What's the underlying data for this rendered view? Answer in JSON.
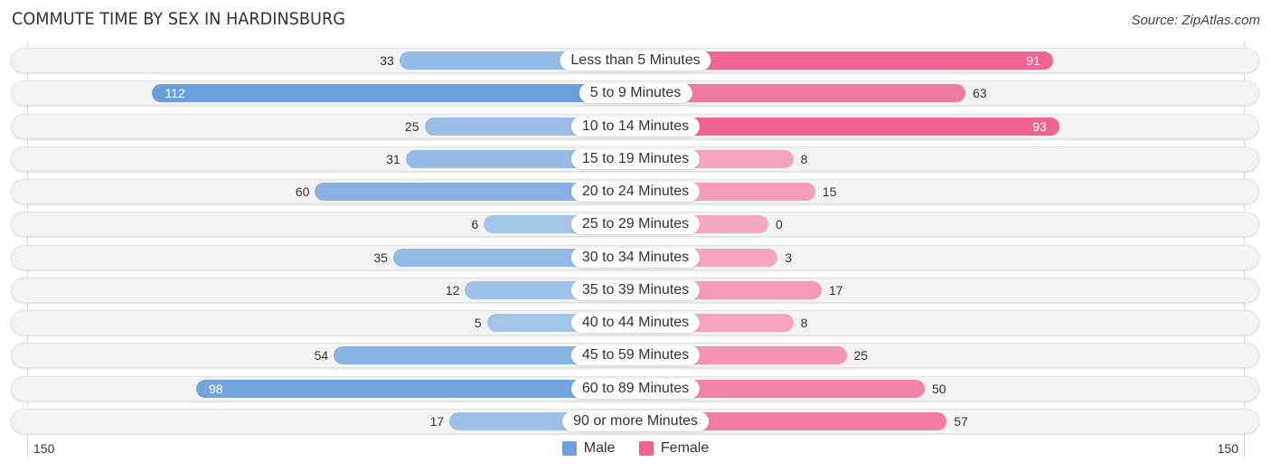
{
  "header": {
    "title": "COMMUTE TIME BY SEX IN HARDINSBURG",
    "source": "Source: ZipAtlas.com"
  },
  "colors": {
    "male_strong": "#6a9fdb",
    "male_light": "#a6c6ea",
    "female_strong": "#f06292",
    "female_light": "#f6a8c0",
    "track": "#f3f3f3"
  },
  "chart_data": {
    "type": "bar",
    "orientation": "horizontal-diverging",
    "title": "COMMUTE TIME BY SEX IN HARDINSBURG",
    "categories": [
      "Less than 5 Minutes",
      "5 to 9 Minutes",
      "10 to 14 Minutes",
      "15 to 19 Minutes",
      "20 to 24 Minutes",
      "25 to 29 Minutes",
      "30 to 34 Minutes",
      "35 to 39 Minutes",
      "40 to 44 Minutes",
      "45 to 59 Minutes",
      "60 to 89 Minutes",
      "90 or more Minutes"
    ],
    "series": [
      {
        "name": "Male",
        "values": [
          33,
          112,
          25,
          31,
          60,
          6,
          35,
          12,
          5,
          54,
          98,
          17
        ]
      },
      {
        "name": "Female",
        "values": [
          91,
          63,
          93,
          8,
          15,
          0,
          3,
          17,
          8,
          25,
          50,
          57
        ]
      }
    ],
    "xlim": [
      -150,
      150
    ],
    "axis_tick_labels": {
      "left": "150",
      "right": "150"
    },
    "legend": {
      "position": "bottom-center",
      "entries": [
        "Male",
        "Female"
      ]
    },
    "grid": false
  }
}
